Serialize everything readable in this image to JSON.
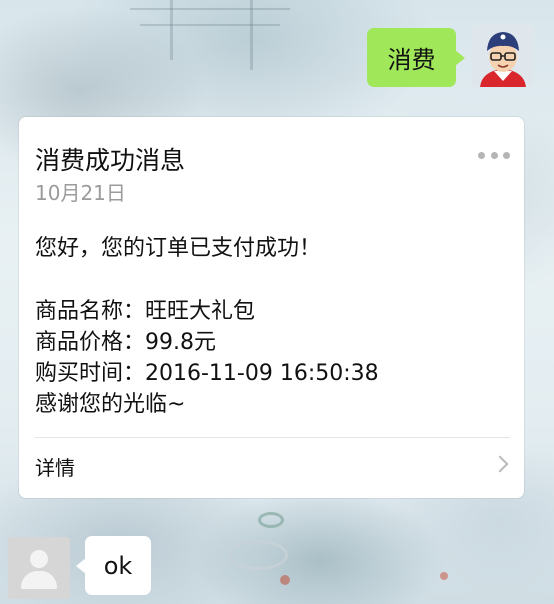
{
  "outgoing_message": {
    "text": "消费",
    "bubble_color": "#a0e75a"
  },
  "card": {
    "title": "消费成功消息",
    "date": "10月21日",
    "greeting": "您好，您的订单已支付成功！",
    "details": [
      "商品名称：旺旺大礼包",
      "商品价格：99.8元",
      "购买时间：2016-11-09 16:50:38",
      "感谢您的光临~"
    ],
    "footer_label": "详情",
    "more_icon": "more-dots-icon",
    "chevron_icon": "chevron-right-icon"
  },
  "incoming_message": {
    "text": "ok",
    "avatar_icon": "default-user-avatar-icon"
  }
}
